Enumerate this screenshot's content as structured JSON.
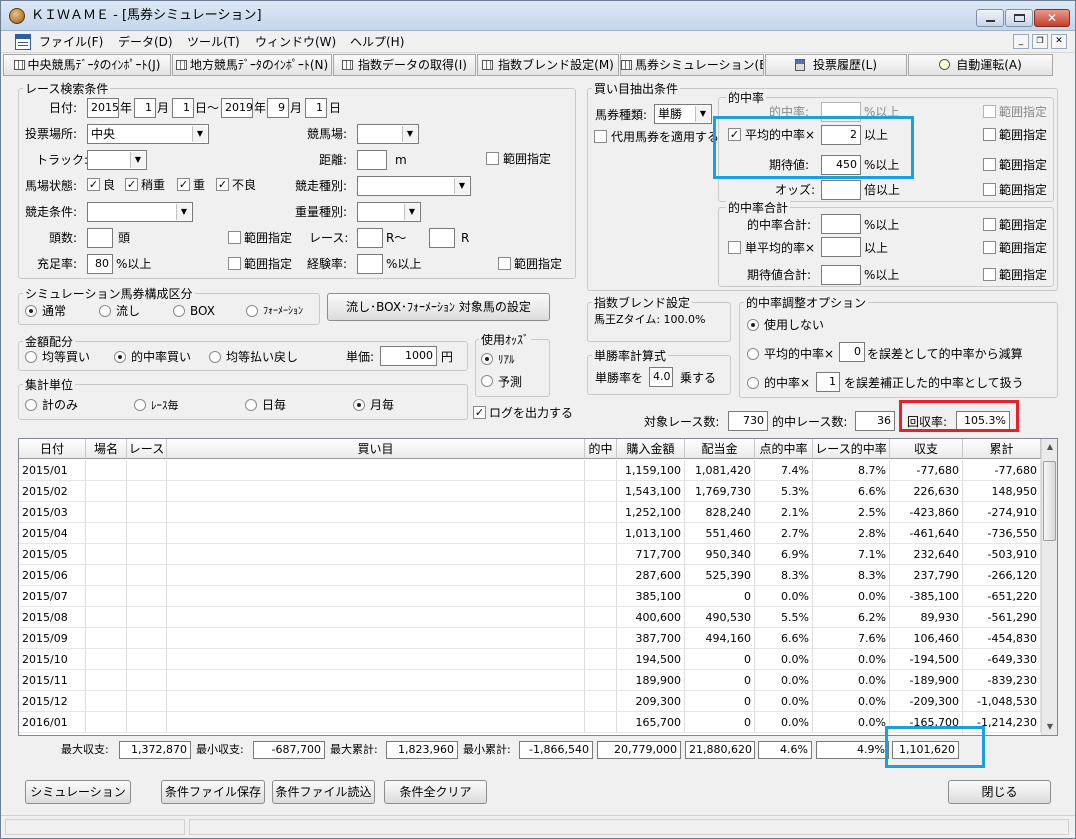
{
  "window": {
    "title": "ＫＩＷＡＭＥ - [馬券シミュレーション]"
  },
  "menu": [
    "ファイル(F)",
    "データ(D)",
    "ツール(T)",
    "ウィンドウ(W)",
    "ヘルプ(H)"
  ],
  "toolbar": [
    "中央競馬ﾃﾞｰﾀのｲﾝﾎﾟｰﾄ(J)",
    "地方競馬ﾃﾞｰﾀのｲﾝﾎﾟｰﾄ(N)",
    "指数データの取得(I)",
    "指数ブレンド設定(M)",
    "馬券シミュレーション(B)",
    "投票履歴(L)",
    "自動運転(A)"
  ],
  "race": {
    "group_label": "レース検索条件",
    "date_label": "日付:",
    "y1": "2015",
    "m1": "1",
    "d1": "1",
    "y2": "2019",
    "m2": "9",
    "d2": "1",
    "u_year": "年",
    "u_month": "月",
    "u_day_tilde": "日～",
    "u_day": "日",
    "venue_label": "投票場所:",
    "venue_value": "中央",
    "course_label": "競馬場:",
    "track_label": "トラック:",
    "distance_label": "距離:",
    "distance_unit": "m",
    "range_label": "範囲指定",
    "cond_label": "馬場状態:",
    "conds": [
      "良",
      "稍重",
      "重",
      "不良"
    ],
    "racetype_label": "競走種別:",
    "racecond_label": "競走条件:",
    "weighttype_label": "重量種別:",
    "heads_label": "頭数:",
    "heads_unit": "頭",
    "racenum_label": "レース:",
    "r_tilde": "R～",
    "r_unit": "R",
    "fill_label": "充足率:",
    "fill_value": "80",
    "fill_unit": "%以上",
    "exp_label": "経験率:",
    "exp_unit": "%以上"
  },
  "composition": {
    "group_label": "シミュレーション馬券構成区分",
    "options": [
      "通常",
      "流し",
      "BOX",
      "ﾌｫｰﾒｰｼｮﾝ"
    ],
    "settings_button": "流し･BOX･ﾌｫｰﾒｰｼｮﾝ 対象馬の設定"
  },
  "allocation": {
    "group_label": "金額配分",
    "options": [
      "均等買い",
      "的中率買い",
      "均等払い戻し"
    ],
    "unit_price_label": "単価:",
    "unit_price": "1000",
    "yen": "円"
  },
  "aggregate": {
    "group_label": "集計単位",
    "options": [
      "計のみ",
      "ﾚｰｽ毎",
      "日毎",
      "月毎"
    ]
  },
  "odds": {
    "group_label": "使用ｵｯｽﾞ",
    "options": [
      "ﾘｱﾙ",
      "予測"
    ]
  },
  "log_label": "ログを出力する",
  "buy": {
    "group_label": "買い目抽出条件",
    "bettype_label": "馬券種類:",
    "bettype_value": "単勝",
    "substitute_label": "代用馬券を適用する"
  },
  "hit": {
    "group_label": "的中率",
    "rate_label": "的中率:",
    "rate_unit": "%以上",
    "avg_label": "平均的中率×",
    "avg_value": "2",
    "avg_unit": "以上",
    "ev_label": "期待値:",
    "ev_value": "450",
    "ev_unit": "%以上",
    "odds_label": "オッズ:",
    "odds_unit": "倍以上",
    "range_label": "範囲指定",
    "sum_group_label": "的中率合計",
    "sum_label": "的中率合計:",
    "sum_unit": "%以上",
    "single_avg_label": "単平均的率×",
    "single_avg_unit": "以上",
    "ev_sum_label": "期待値合計:",
    "ev_sum_unit": "%以上"
  },
  "blend": {
    "group_label": "指数ブレンド設定",
    "text": "馬王Zタイム: 100.0%"
  },
  "win_formula": {
    "group_label": "単勝率計算式",
    "label": "単勝率を",
    "value": "4.0",
    "unit": "乗する"
  },
  "adjust": {
    "group_label": "的中率調整オプション",
    "opt1": "使用しない",
    "opt2a": "平均的中率×",
    "opt2_value": "0",
    "opt2b": "を誤差として的中率から減算",
    "opt3a": "的中率×",
    "opt3_value": "1",
    "opt3b": "を誤差補正した的中率として扱う"
  },
  "stats": {
    "target_label": "対象レース数:",
    "target": "730",
    "hits_label": "的中レース数:",
    "hits": "36",
    "return_label": "回収率:",
    "return": "105.3%"
  },
  "table": {
    "headers": [
      "日付",
      "場名",
      "レース",
      "買い目",
      "的中",
      "購入金額",
      "配当金",
      "点的中率",
      "レース的中率",
      "収支",
      "累計"
    ],
    "rows": [
      [
        "2015/01",
        "",
        "",
        "",
        "",
        "1,159,100",
        "1,081,420",
        "7.4%",
        "8.7%",
        "-77,680",
        "-77,680"
      ],
      [
        "2015/02",
        "",
        "",
        "",
        "",
        "1,543,100",
        "1,769,730",
        "5.3%",
        "6.6%",
        "226,630",
        "148,950"
      ],
      [
        "2015/03",
        "",
        "",
        "",
        "",
        "1,252,100",
        "828,240",
        "2.1%",
        "2.5%",
        "-423,860",
        "-274,910"
      ],
      [
        "2015/04",
        "",
        "",
        "",
        "",
        "1,013,100",
        "551,460",
        "2.7%",
        "2.8%",
        "-461,640",
        "-736,550"
      ],
      [
        "2015/05",
        "",
        "",
        "",
        "",
        "717,700",
        "950,340",
        "6.9%",
        "7.1%",
        "232,640",
        "-503,910"
      ],
      [
        "2015/06",
        "",
        "",
        "",
        "",
        "287,600",
        "525,390",
        "8.3%",
        "8.3%",
        "237,790",
        "-266,120"
      ],
      [
        "2015/07",
        "",
        "",
        "",
        "",
        "385,100",
        "0",
        "0.0%",
        "0.0%",
        "-385,100",
        "-651,220"
      ],
      [
        "2015/08",
        "",
        "",
        "",
        "",
        "400,600",
        "490,530",
        "5.5%",
        "6.2%",
        "89,930",
        "-561,290"
      ],
      [
        "2015/09",
        "",
        "",
        "",
        "",
        "387,700",
        "494,160",
        "6.6%",
        "7.6%",
        "106,460",
        "-454,830"
      ],
      [
        "2015/10",
        "",
        "",
        "",
        "",
        "194,500",
        "0",
        "0.0%",
        "0.0%",
        "-194,500",
        "-649,330"
      ],
      [
        "2015/11",
        "",
        "",
        "",
        "",
        "189,900",
        "0",
        "0.0%",
        "0.0%",
        "-189,900",
        "-839,230"
      ],
      [
        "2015/12",
        "",
        "",
        "",
        "",
        "209,300",
        "0",
        "0.0%",
        "0.0%",
        "-209,300",
        "-1,048,530"
      ],
      [
        "2016/01",
        "",
        "",
        "",
        "",
        "165,700",
        "0",
        "0.0%",
        "0.0%",
        "-165,700",
        "-1,214,230"
      ]
    ]
  },
  "footer": {
    "max_profit_label": "最大収支:",
    "max_profit": "1,372,870",
    "min_profit_label": "最小収支:",
    "min_profit": "-687,700",
    "max_cum_label": "最大累計:",
    "max_cum": "1,823,960",
    "min_cum_label": "最小累計:",
    "min_cum": "-1,866,540",
    "total_buy": "20,779,000",
    "total_payout": "21,880,620",
    "point_rate": "4.6%",
    "race_rate": "4.9%",
    "total_profit": "1,101,620"
  },
  "buttons": {
    "simulate": "シミュレーション",
    "save": "条件ファイル保存",
    "load": "条件ファイル読込",
    "clear": "条件全クリア",
    "close": "閉じる"
  },
  "colors": {
    "highlight_blue": "#1a9fe0",
    "highlight_red": "#e8202a"
  }
}
